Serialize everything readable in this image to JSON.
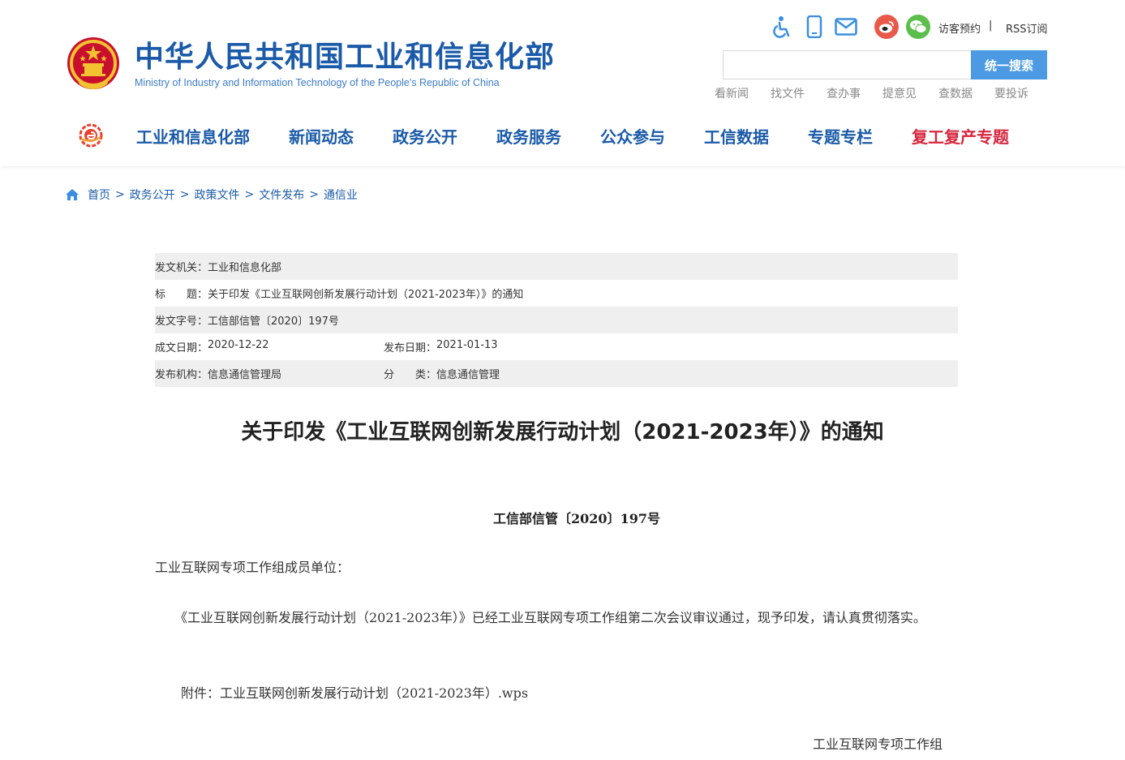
{
  "header": {
    "title": "中华人民共和国工业和信息化部",
    "subtitle": "Ministry of Industry and Information Technology of the People's Republic of China",
    "visitor_link": "访客预约",
    "separator": "|",
    "rss_link": "RSS订阅",
    "search": {
      "placeholder": "",
      "button": "统一搜索"
    },
    "quick_links": [
      "看新闻",
      "找文件",
      "查办事",
      "提意见",
      "查数据",
      "要投诉"
    ],
    "icons": [
      "accessibility-icon",
      "mobile-icon",
      "mail-icon",
      "weibo-icon",
      "wechat-icon"
    ]
  },
  "nav": {
    "items": [
      "工业和信息化部",
      "新闻动态",
      "政务公开",
      "政务服务",
      "公众参与",
      "工信数据",
      "专题专栏"
    ],
    "highlight_item": "复工复产专题",
    "highlight_color": "#d7263d"
  },
  "breadcrumb": [
    "首页",
    "政务公开",
    "政策文件",
    "文件发布",
    "通信业"
  ],
  "info": {
    "issuer_label": "发文机关：",
    "issuer": "工业和信息化部",
    "title_label": "标　　题：",
    "title": "关于印发《工业互联网创新发展行动计划（2021-2023年）》的通知",
    "doc_no_label": "发文字号：",
    "doc_no": "工信部信管〔2020〕197号",
    "created_label": "成文日期：",
    "created": "2020-12-22",
    "published_label": "发布日期：",
    "published": "2021-01-13",
    "org_label": "发布机构：",
    "org": "信息通信管理局",
    "category_label": "分　　类：",
    "category": "信息通信管理"
  },
  "article": {
    "title": "关于印发《工业互联网创新发展行动计划（2021-2023年）》的通知",
    "doc_number": "工信部信管〔2020〕197号",
    "recipient": "工业互联网专项工作组成员单位：",
    "body": "　　《工业互联网创新发展行动计划（2021-2023年）》已经工业互联网专项工作组第二次会议审议通过，现予印发，请认真贯彻落实。",
    "attachment": "　　附件：工业互联网创新发展行动计划（2021-2023年）.wps",
    "signature": "工业互联网专项工作组"
  },
  "colors": {
    "brand_blue": "#1a5aa8",
    "search_button": "#4b9ae3",
    "table_shade": "#efefef"
  }
}
